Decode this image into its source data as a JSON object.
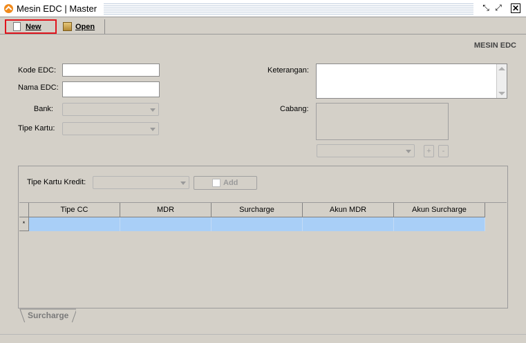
{
  "window": {
    "title": "Mesin EDC | Master",
    "icons": [
      "app-icon",
      "restore-icon",
      "maximize-icon",
      "close-icon"
    ]
  },
  "toolbar": {
    "new_label": "New",
    "open_label": "Open",
    "new_icon": "document-icon",
    "open_icon": "folder-icon"
  },
  "form": {
    "section_title": "MESIN EDC",
    "kode_edc_label": "Kode EDC:",
    "kode_edc_value": "",
    "nama_edc_label": "Nama EDC:",
    "nama_edc_value": "",
    "bank_label": "Bank:",
    "bank_value": "",
    "tipe_kartu_label": "Tipe Kartu:",
    "tipe_kartu_value": "",
    "keterangan_label": "Keterangan:",
    "keterangan_value": "",
    "cabang_label": "Cabang:",
    "cabang_add": "+",
    "cabang_remove": "-"
  },
  "surcharge": {
    "tipe_kartu_kredit_label": "Tipe Kartu Kredit:",
    "tipe_kartu_kredit_value": "",
    "add_label": "Add",
    "columns": [
      "Tipe CC",
      "MDR",
      "Surcharge",
      "Akun MDR",
      "Akun Surcharge"
    ],
    "new_row_marker": "*",
    "tab_label": "Surcharge"
  },
  "colors": {
    "accent_highlight": "#e0141c",
    "selected_row": "#a9cff7",
    "window_bg": "#d4d0c8"
  }
}
